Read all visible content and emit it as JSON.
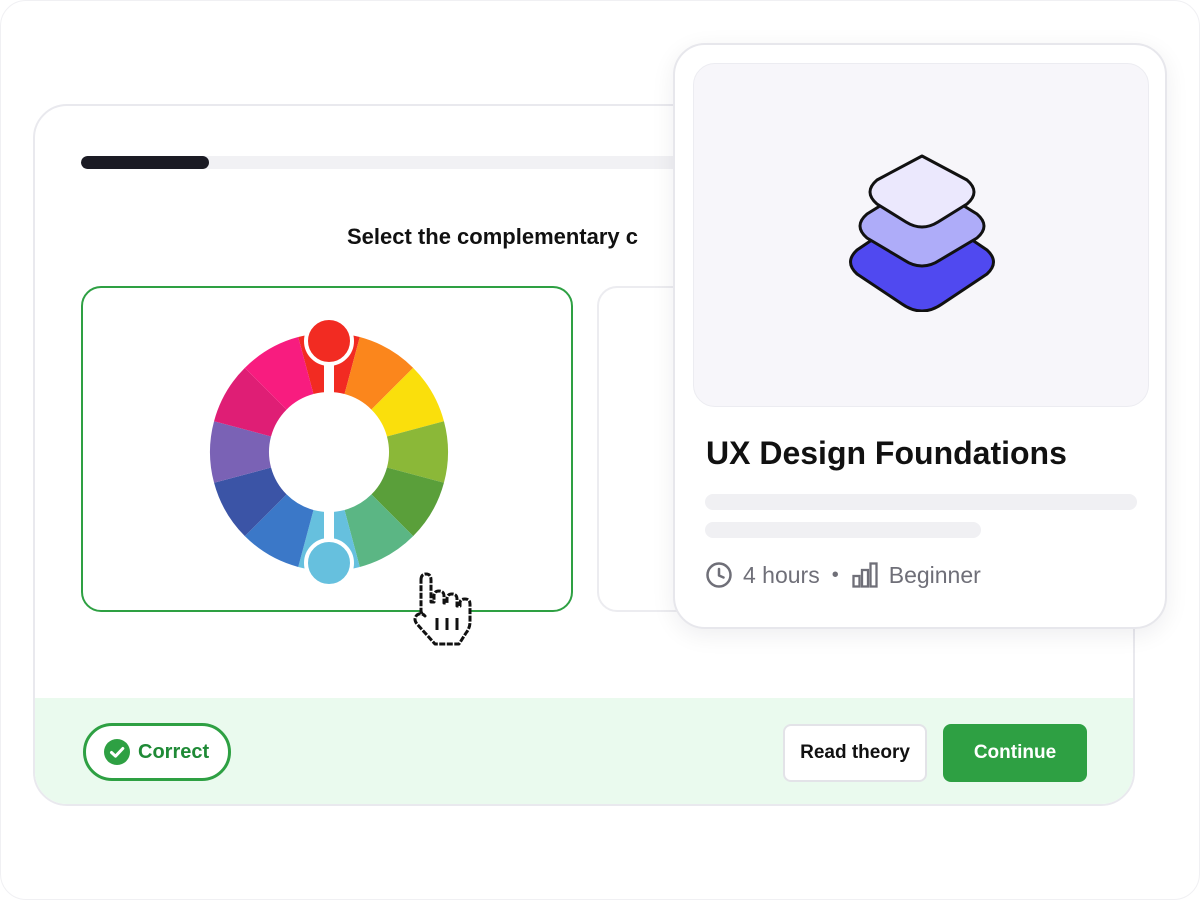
{
  "quiz": {
    "progress_fraction": 0.2,
    "question": "Select the complementary c",
    "feedback": {
      "status_label": "Correct",
      "read_theory_label": "Read theory",
      "continue_label": "Continue"
    },
    "wheel_colors": [
      "#f22b22",
      "#fb861c",
      "#fadf0c",
      "#8bb838",
      "#5a9f3a",
      "#5bb684",
      "#66c0de",
      "#3b78c8",
      "#3b54a6",
      "#7a62b5",
      "#df1e75",
      "#f81c7f"
    ],
    "selected_top_color": "#f22b22",
    "selected_bottom_color": "#66c0de"
  },
  "course": {
    "title": "UX Design Foundations",
    "duration": "4 hours",
    "level": "Beginner",
    "layer_colors": [
      "#ebe8fd",
      "#aeacf9",
      "#5049f0"
    ]
  },
  "colors": {
    "success": "#2ea043",
    "success_bg": "#eafaee",
    "text_muted": "#6f6f78"
  }
}
